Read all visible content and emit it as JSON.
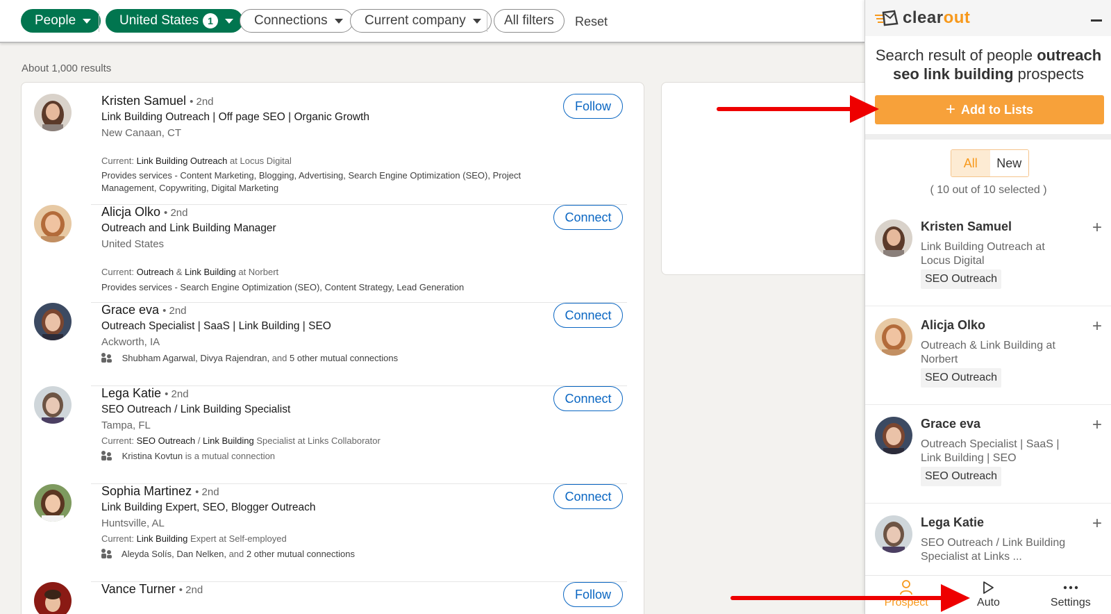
{
  "filters": {
    "people": "People",
    "country": "United States",
    "country_count": "1",
    "connections": "Connections",
    "current_company": "Current company",
    "all_filters": "All filters",
    "reset": "Reset"
  },
  "results": {
    "count": "About 1,000 results",
    "items": [
      {
        "name": "Kristen Samuel",
        "degree": "• 2nd",
        "headline": "Link Building Outreach | Off page SEO | Organic Growth",
        "location": "New Canaan, CT",
        "current_prefix": "Current:",
        "current_role": "Link Building Outreach",
        "current_suffix": "at Locus Digital",
        "services": "Provides services - Content Marketing, Blogging, Advertising, Search Engine Optimization (SEO), Project Management, Copywriting, Digital Marketing",
        "action": "Follow"
      },
      {
        "name": "Alicja Olko",
        "degree": "• 2nd",
        "headline": "Outreach and Link Building Manager",
        "location": "United States",
        "current_prefix": "Current:",
        "current_role_a": "Outreach",
        "current_amp": "&",
        "current_role_b": "Link Building",
        "current_suffix": "at Norbert",
        "services": "Provides services - Search Engine Optimization (SEO), Content Strategy, Lead Generation",
        "action": "Connect"
      },
      {
        "name": "Grace eva",
        "degree": "• 2nd",
        "headline": "Outreach Specialist | SaaS | Link Building | SEO",
        "location": "Ackworth, IA",
        "mutual_names": "Shubham Agarwal, Divya Rajendran,",
        "mutual_and": "and",
        "mutual_other": "5 other mutual connections",
        "action": "Connect"
      },
      {
        "name": "Lega Katie",
        "degree": "• 2nd",
        "headline": "SEO Outreach / Link Building Specialist",
        "location": "Tampa, FL",
        "current_prefix": "Current:",
        "current_role_a": "SEO Outreach",
        "current_amp": "/",
        "current_role_b": "Link Building",
        "current_suffix": "Specialist at Links Collaborator",
        "mutual_names": "Kristina Kovtun",
        "mutual_rest": "is a mutual connection",
        "action": "Connect"
      },
      {
        "name": "Sophia Martinez",
        "degree": "• 2nd",
        "headline": "Link Building Expert, SEO, Blogger Outreach",
        "location": "Huntsville, AL",
        "current_prefix": "Current:",
        "current_role": "Link Building",
        "current_suffix": "Expert at Self-employed",
        "mutual_names": "Aleyda Solís, Dan Nelken,",
        "mutual_and": "and",
        "mutual_other": "2 other mutual connections",
        "action": "Connect"
      },
      {
        "name": "Vance Turner",
        "degree": "• 2nd",
        "action": "Follow"
      }
    ]
  },
  "clearout": {
    "logo_a": "clear",
    "logo_b": "out",
    "title_a": "Search result of people",
    "title_b": "outreach",
    "title_c": "seo link building",
    "title_d": "prospects",
    "add_to_lists": "Add to Lists",
    "add_plus": "+",
    "toggle_all": "All",
    "toggle_new": "New",
    "selected": "( 10 out of 10 selected )",
    "items": [
      {
        "name": "Kristen Samuel",
        "desc": "Link Building Outreach at Locus Digital",
        "tag": "SEO Outreach"
      },
      {
        "name": "Alicja Olko",
        "desc": "Outreach & Link Building at Norbert",
        "tag": "SEO Outreach"
      },
      {
        "name": "Grace eva",
        "desc": "Outreach Specialist | SaaS | Link Building | SEO",
        "tag": "SEO Outreach"
      },
      {
        "name": "Lega Katie",
        "desc": "SEO Outreach / Link Building Specialist at Links ..."
      }
    ],
    "item_plus": "+",
    "tabs": {
      "prospect": "Prospect",
      "auto": "Auto",
      "settings": "Settings"
    },
    "accent_color": "#f7991c"
  },
  "annotation_color": "#e00000"
}
